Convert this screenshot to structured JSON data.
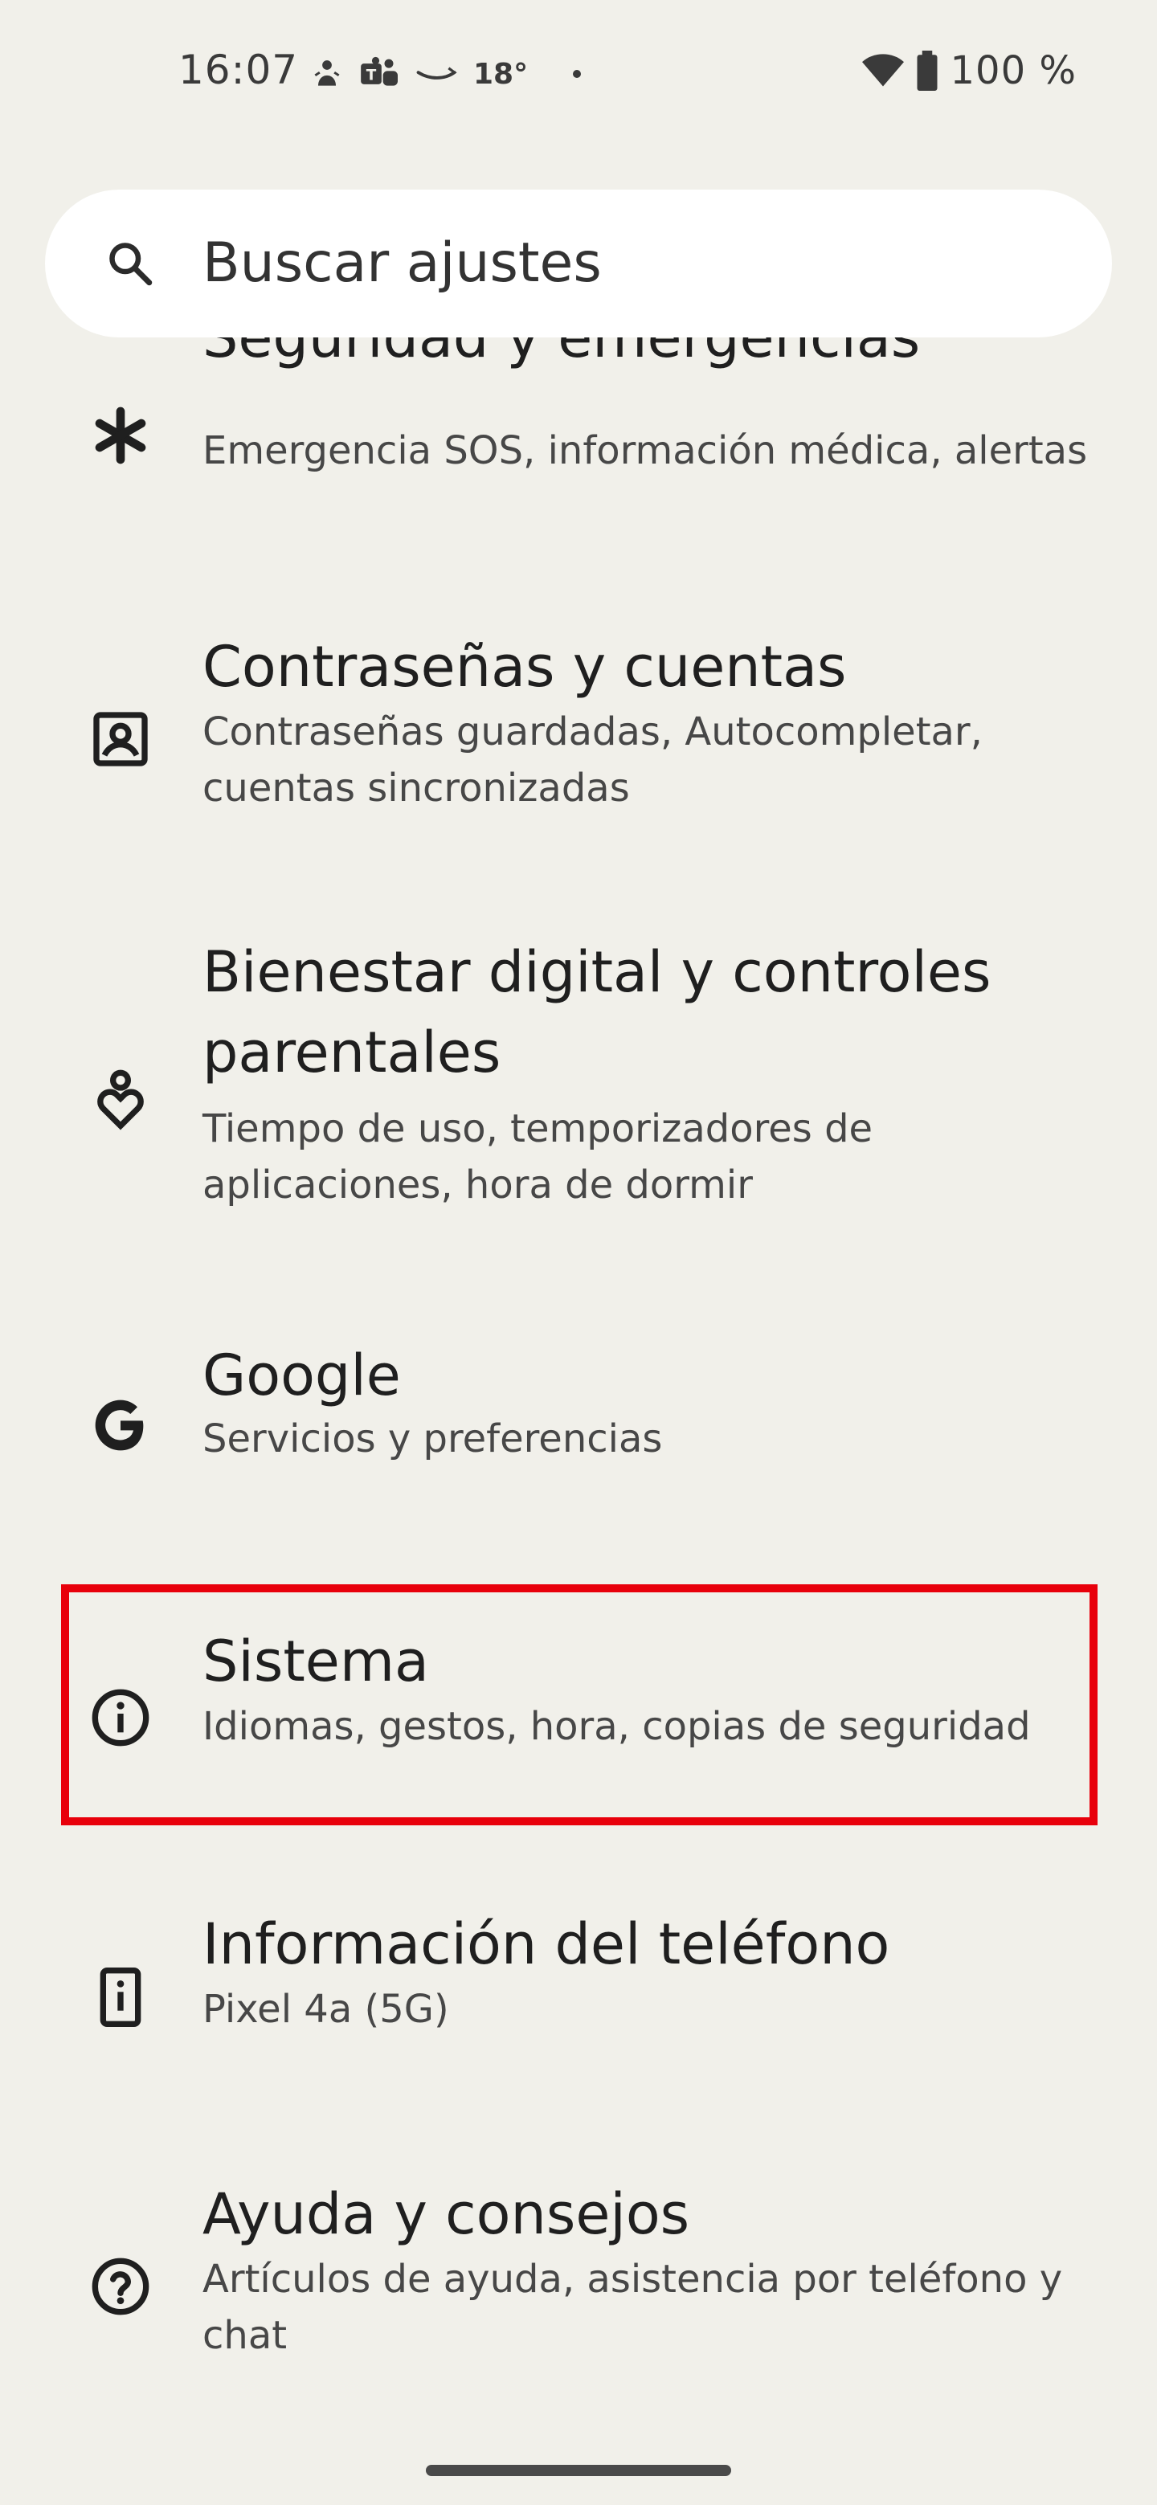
{
  "status_bar": {
    "time": "16:07",
    "temperature": "18°",
    "battery": "100 %",
    "icons": [
      "notification-icon",
      "teams-icon",
      "amazon-icon",
      "wifi-icon",
      "battery-icon"
    ]
  },
  "search": {
    "placeholder": "Buscar ajustes"
  },
  "settings": [
    {
      "title": "Seguridad y emergencias",
      "subtitle": "Emergencia SOS, información médica, alertas",
      "icon": "asterisk-icon"
    },
    {
      "title": "Contraseñas y cuentas",
      "subtitle": "Contraseñas guardadas, Autocompletar, cuentas sincronizadas",
      "icon": "account-box-icon"
    },
    {
      "title": "Bienestar digital y controles parentales",
      "subtitle": "Tiempo de uso, temporizadores de aplicaciones, hora de dormir",
      "icon": "wellbeing-icon"
    },
    {
      "title": "Google",
      "subtitle": "Servicios y preferencias",
      "icon": "google-icon"
    },
    {
      "title": "Sistema",
      "subtitle": "Idiomas, gestos, hora, copias de seguridad",
      "icon": "info-icon"
    },
    {
      "title": "Información del teléfono",
      "subtitle": "Pixel 4a (5G)",
      "icon": "phone-info-icon"
    },
    {
      "title": "Ayuda y consejos",
      "subtitle": "Artículos de ayuda, asistencia por teléfono y chat",
      "icon": "help-icon"
    }
  ],
  "colors": {
    "background": "#f1f0ea",
    "highlight": "#e8000b",
    "search_bg": "#ffffff"
  }
}
